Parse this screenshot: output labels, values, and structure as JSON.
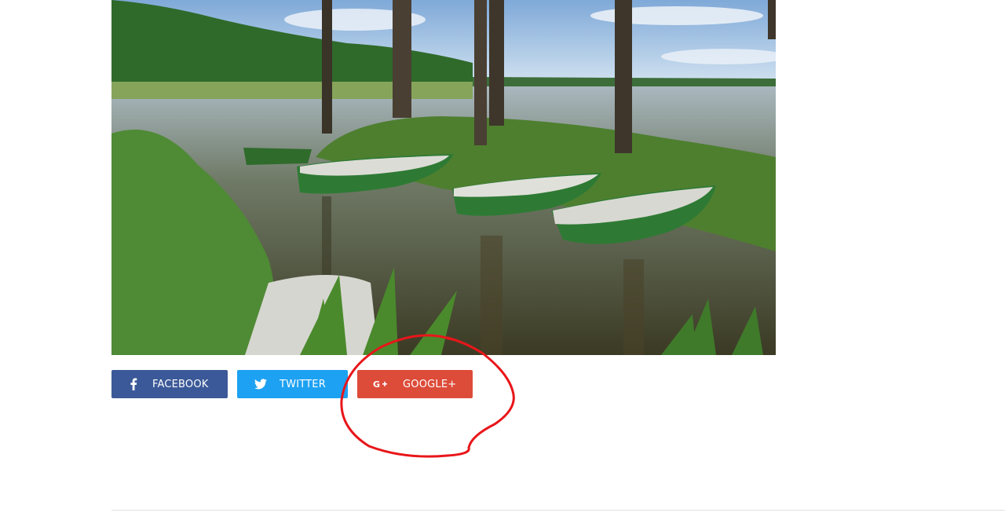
{
  "share": {
    "facebook": {
      "label": "FACEBOOK",
      "icon": "facebook-icon",
      "color": "#3b5998"
    },
    "twitter": {
      "label": "TWITTER",
      "icon": "twitter-icon",
      "color": "#1da1f2"
    },
    "google": {
      "label": "GOOGLE+",
      "icon": "google-plus-icon",
      "color": "#dd4b39"
    }
  },
  "annotation": {
    "color": "#e8161a"
  }
}
